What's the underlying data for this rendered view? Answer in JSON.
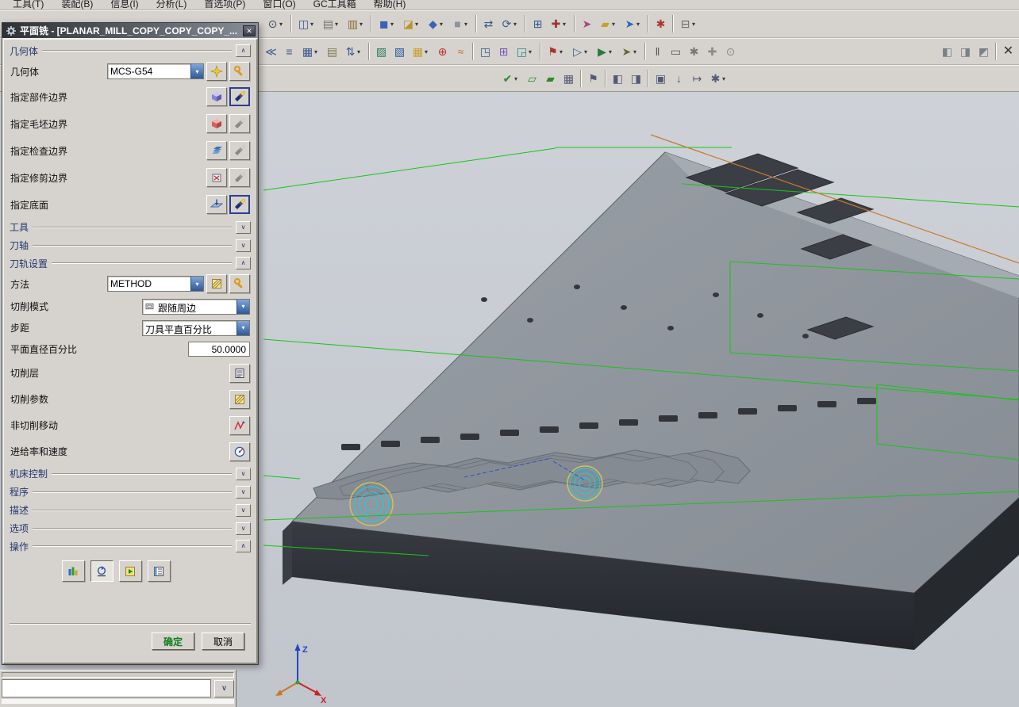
{
  "glyphs": {
    "up": "∧",
    "down": "∨",
    "combo": "▾",
    "close": "✕"
  },
  "menu": {
    "items": [
      "工具(T)",
      "装配(B)",
      "信息(I)",
      "分析(L)",
      "首选项(P)",
      "窗口(O)",
      "GC工具箱",
      "帮助(H)"
    ]
  },
  "toolbars": {
    "row1": [
      {
        "name": "zoom-tool-button",
        "glyph": "⊙",
        "css": "color:#3a4a5a",
        "dd": "▾",
        "cls": "tbtn",
        "inter": "true"
      },
      {
        "name": "toolbar-separator",
        "glyph": "",
        "css": "",
        "dd": "",
        "cls": "tsep",
        "inter": "false"
      },
      {
        "name": "window-split-button",
        "glyph": "◫",
        "css": "color:#39598f",
        "dd": "▾",
        "cls": "tbtn",
        "inter": "true"
      },
      {
        "name": "display-stairs-button",
        "glyph": "▤",
        "css": "color:#707070",
        "dd": "▾",
        "cls": "tbtn",
        "inter": "true"
      },
      {
        "name": "clipboard-button",
        "glyph": "▥",
        "css": "color:#8a6a30",
        "dd": "▾",
        "cls": "tbtn",
        "inter": "true"
      },
      {
        "name": "toolbar-separator",
        "glyph": "",
        "css": "",
        "dd": "",
        "cls": "tsep",
        "inter": "false"
      },
      {
        "name": "solid-body-button",
        "glyph": "◼",
        "css": "color:#3a63b5",
        "dd": "▾",
        "cls": "tbtn",
        "inter": "true"
      },
      {
        "name": "sheet-body-button",
        "glyph": "◪",
        "css": "color:#b8953a",
        "dd": "▾",
        "cls": "tbtn",
        "inter": "true"
      },
      {
        "name": "facet-body-button",
        "glyph": "◆",
        "css": "color:#3a63b5",
        "dd": "▾",
        "cls": "tbtn",
        "inter": "true"
      },
      {
        "name": "shaded-display-button",
        "glyph": "■",
        "css": "color:#8d939b",
        "dd": "▾",
        "cls": "tbtn",
        "inter": "true"
      },
      {
        "name": "toolbar-separator",
        "glyph": "",
        "css": "",
        "dd": "",
        "cls": "tsep",
        "inter": "false"
      },
      {
        "name": "pan-view-button",
        "glyph": "⇄",
        "css": "color:#39598f",
        "dd": "",
        "cls": "tbtn",
        "inter": "true"
      },
      {
        "name": "rotate-view-button",
        "glyph": "⟳",
        "css": "color:#39598f",
        "dd": "▾",
        "cls": "tbtn",
        "inter": "true"
      },
      {
        "name": "toolbar-separator",
        "glyph": "",
        "css": "",
        "dd": "",
        "cls": "tsep",
        "inter": "false"
      },
      {
        "name": "grid-button",
        "glyph": "⊞",
        "css": "color:#39598f",
        "dd": "",
        "cls": "tbtn",
        "inter": "true"
      },
      {
        "name": "datum-button",
        "glyph": "✚",
        "css": "color:#a03434",
        "dd": "▾",
        "cls": "tbtn",
        "inter": "true"
      },
      {
        "name": "toolbar-separator",
        "glyph": "",
        "css": "",
        "dd": "",
        "cls": "tsep",
        "inter": "false"
      },
      {
        "name": "measure-button",
        "glyph": "➤",
        "css": "color:#a34a78",
        "dd": "",
        "cls": "tbtn",
        "inter": "true"
      },
      {
        "name": "highlight-brush-button",
        "glyph": "▰",
        "css": "color:#c8a028",
        "dd": "▾",
        "cls": "tbtn",
        "inter": "true"
      },
      {
        "name": "vector-button",
        "glyph": "➤",
        "css": "color:#2a6ac0",
        "dd": "▾",
        "cls": "tbtn",
        "inter": "true"
      },
      {
        "name": "toolbar-separator",
        "glyph": "",
        "css": "",
        "dd": "",
        "cls": "tsep",
        "inter": "false"
      },
      {
        "name": "constraint-button",
        "glyph": "✱",
        "css": "color:#b03434",
        "dd": "",
        "cls": "tbtn",
        "inter": "true"
      },
      {
        "name": "toolbar-separator",
        "glyph": "",
        "css": "",
        "dd": "",
        "cls": "tsep",
        "inter": "false"
      },
      {
        "name": "ruler-button",
        "glyph": "⊟",
        "css": "color:#6a6a6a",
        "dd": "▾",
        "cls": "tbtn",
        "inter": "true"
      }
    ],
    "row2": [
      {
        "name": "align-button",
        "glyph": "≪",
        "css": "color:#39598f",
        "dd": "",
        "cls": "tbtn",
        "inter": "true"
      },
      {
        "name": "operation-list-button",
        "glyph": "≡",
        "css": "color:#39598f",
        "dd": "",
        "cls": "tbtn",
        "inter": "true"
      },
      {
        "name": "pattern-button",
        "glyph": "▦",
        "css": "color:#39598f",
        "dd": "▾",
        "cls": "tbtn",
        "inter": "true"
      },
      {
        "name": "notes-button",
        "glyph": "▤",
        "css": "color:#7a7a4a",
        "dd": "",
        "cls": "tbtn",
        "inter": "true"
      },
      {
        "name": "reorder-button",
        "glyph": "⇅",
        "css": "color:#39598f",
        "dd": "▾",
        "cls": "tbtn",
        "inter": "true"
      },
      {
        "name": "toolbar-separator",
        "glyph": "",
        "css": "",
        "dd": "",
        "cls": "tsep",
        "inter": "false"
      },
      {
        "name": "check-geometry-button",
        "glyph": "▨",
        "css": "color:#2a7a5a",
        "dd": "",
        "cls": "tbtn",
        "inter": "true"
      },
      {
        "name": "section-view-button",
        "glyph": "▧",
        "css": "color:#2a5a9a",
        "dd": "",
        "cls": "tbtn",
        "inter": "true"
      },
      {
        "name": "mesh-button",
        "glyph": "▦",
        "css": "color:#c8a028",
        "dd": "▾",
        "cls": "tbtn",
        "inter": "true"
      },
      {
        "name": "point-button",
        "glyph": "⊕",
        "css": "color:#c03030",
        "dd": "",
        "cls": "tbtn",
        "inter": "true"
      },
      {
        "name": "spline-button",
        "glyph": "≈",
        "css": "color:#c07030",
        "dd": "",
        "cls": "tbtn",
        "inter": "true"
      },
      {
        "name": "toolbar-separator",
        "glyph": "",
        "css": "",
        "dd": "",
        "cls": "tsep",
        "inter": "false"
      },
      {
        "name": "csys-button",
        "glyph": "◳",
        "css": "color:#39598f",
        "dd": "",
        "cls": "tbtn",
        "inter": "true"
      },
      {
        "name": "plane-button",
        "glyph": "⊞",
        "css": "color:#7a5ac0",
        "dd": "",
        "cls": "tbtn",
        "inter": "true"
      },
      {
        "name": "offset-button",
        "glyph": "◲",
        "css": "color:#2a8a8a",
        "dd": "▾",
        "cls": "tbtn",
        "inter": "true"
      },
      {
        "name": "toolbar-separator",
        "glyph": "",
        "css": "",
        "dd": "",
        "cls": "tsep",
        "inter": "false"
      },
      {
        "name": "flag-button",
        "glyph": "⚑",
        "css": "color:#b03030",
        "dd": "▾",
        "cls": "tbtn",
        "inter": "true"
      },
      {
        "name": "play-outline-button",
        "glyph": "▷",
        "css": "color:#39598f",
        "dd": "▾",
        "cls": "tbtn",
        "inter": "true"
      },
      {
        "name": "play-button",
        "glyph": "▶",
        "css": "color:#2a7a3a",
        "dd": "▾",
        "cls": "tbtn",
        "inter": "true"
      },
      {
        "name": "probe-button",
        "glyph": "➤",
        "css": "color:#6a6a3a",
        "dd": "▾",
        "cls": "tbtn",
        "inter": "true"
      },
      {
        "name": "toolbar-separator",
        "glyph": "",
        "css": "",
        "dd": "",
        "cls": "tsep",
        "inter": "false"
      },
      {
        "name": "post-button",
        "glyph": "‖",
        "css": "color:#555",
        "dd": "",
        "cls": "tbtn",
        "inter": "true"
      },
      {
        "name": "shop-doc-button",
        "glyph": "▭",
        "css": "color:#555",
        "dd": "",
        "cls": "tbtn",
        "inter": "true"
      },
      {
        "name": "toolpath-tools-button",
        "glyph": "✱",
        "css": "color:#777",
        "dd": "",
        "cls": "tbtn",
        "inter": "true"
      },
      {
        "name": "add-button",
        "glyph": "✚",
        "css": "color:#8a8a8a",
        "dd": "",
        "cls": "tbtn",
        "inter": "true"
      },
      {
        "name": "find-button",
        "glyph": "⊙",
        "css": "color:#8a8a8a",
        "dd": "",
        "cls": "tbtn",
        "inter": "true"
      },
      {
        "name": "cube-view-a-button",
        "glyph": "◧",
        "css": "color:#7a8088",
        "dd": "",
        "cls": "tbtn push",
        "inter": "true"
      },
      {
        "name": "cube-view-b-button",
        "glyph": "◨",
        "css": "color:#7a8088",
        "dd": "",
        "cls": "tbtn",
        "inter": "true"
      },
      {
        "name": "cube-view-c-button",
        "glyph": "◩",
        "css": "color:#7a8088",
        "dd": "",
        "cls": "tbtn",
        "inter": "true"
      },
      {
        "name": "toolbar-separator",
        "glyph": "",
        "css": "",
        "dd": "",
        "cls": "tsep",
        "inter": "false"
      },
      {
        "name": "close-toolbar-button",
        "glyph": "✕",
        "css": "color:#333",
        "dd": "",
        "cls": "tbtn tbig",
        "inter": "true"
      }
    ],
    "row3": [
      {
        "name": "verify-check-button",
        "glyph": "✔",
        "css": "color:#2a8a2a",
        "dd": "▾",
        "cls": "tbtn",
        "inter": "true"
      },
      {
        "name": "folder-open-button",
        "glyph": "▱",
        "css": "color:#2a8a2a",
        "dd": "",
        "cls": "tbtn",
        "inter": "true"
      },
      {
        "name": "folder-button",
        "glyph": "▰",
        "css": "color:#2a8a2a",
        "dd": "",
        "cls": "tbtn",
        "inter": "true"
      },
      {
        "name": "table-button",
        "glyph": "▦",
        "css": "color:#555a77",
        "dd": "",
        "cls": "tbtn",
        "inter": "true"
      },
      {
        "name": "toolbar-separator",
        "glyph": "",
        "css": "",
        "dd": "",
        "cls": "tsep",
        "inter": "false"
      },
      {
        "name": "signal-flag-button",
        "glyph": "⚑",
        "css": "color:#555a77",
        "dd": "",
        "cls": "tbtn",
        "inter": "true"
      },
      {
        "name": "toolbar-separator",
        "glyph": "",
        "css": "",
        "dd": "",
        "cls": "tsep",
        "inter": "false"
      },
      {
        "name": "monitor-left-button",
        "glyph": "◧",
        "css": "color:#555a77",
        "dd": "",
        "cls": "tbtn",
        "inter": "true"
      },
      {
        "name": "monitor-right-button",
        "glyph": "◨",
        "css": "color:#555a77",
        "dd": "",
        "cls": "tbtn",
        "inter": "true"
      },
      {
        "name": "toolbar-separator",
        "glyph": "",
        "css": "",
        "dd": "",
        "cls": "tsep",
        "inter": "false"
      },
      {
        "name": "copy-operation-button",
        "glyph": "▣",
        "css": "color:#555a77",
        "dd": "",
        "cls": "tbtn",
        "inter": "true"
      },
      {
        "name": "download-button",
        "glyph": "↓",
        "css": "color:#555a77",
        "dd": "",
        "cls": "tbtn",
        "inter": "true"
      },
      {
        "name": "link-button",
        "glyph": "↦",
        "css": "color:#555a77",
        "dd": "",
        "cls": "tbtn",
        "inter": "true"
      },
      {
        "name": "sim-settings-button",
        "glyph": "✱",
        "css": "color:#555a77",
        "dd": "▾",
        "cls": "tbtn",
        "inter": "true"
      }
    ]
  },
  "dialog": {
    "title": "平面铣 - [PLANAR_MILL_COPY_COPY_COPY_...",
    "geometry_header": "几何体",
    "geometry_label": "几何体",
    "geometry_value": "MCS-G54",
    "boundary_rows": [
      "指定部件边界",
      "指定毛坯边界",
      "指定检查边界",
      "指定修剪边界",
      "指定底面"
    ],
    "tool_header": "工具",
    "axis_header": "刀轴",
    "path_header": "刀轨设置",
    "method_label": "方法",
    "method_value": "METHOD",
    "cut_mode_label": "切削模式",
    "cut_mode_value": "跟随周边",
    "stepover_label": "步距",
    "stepover_value": "刀具平直百分比",
    "percent_label": "平面直径百分比",
    "percent_value": "50.0000",
    "cut_levels_label": "切削层",
    "cut_params_label": "切削参数",
    "noncut_label": "非切削移动",
    "feeds_label": "进给率和速度",
    "machine_header": "机床控制",
    "program_header": "程序",
    "description_header": "描述",
    "options_header": "选项",
    "actions_header": "操作",
    "ok_label": "确定",
    "cancel_label": "取消"
  },
  "viewport": {
    "triad_x": "X",
    "triad_z": "Z",
    "colors": {
      "boundary": "#17c517",
      "toolpath": "#0cd6e6",
      "engage_helix": "#d2c054",
      "rapid": "#3050c8",
      "highlight_edge": "#c87a28"
    }
  }
}
